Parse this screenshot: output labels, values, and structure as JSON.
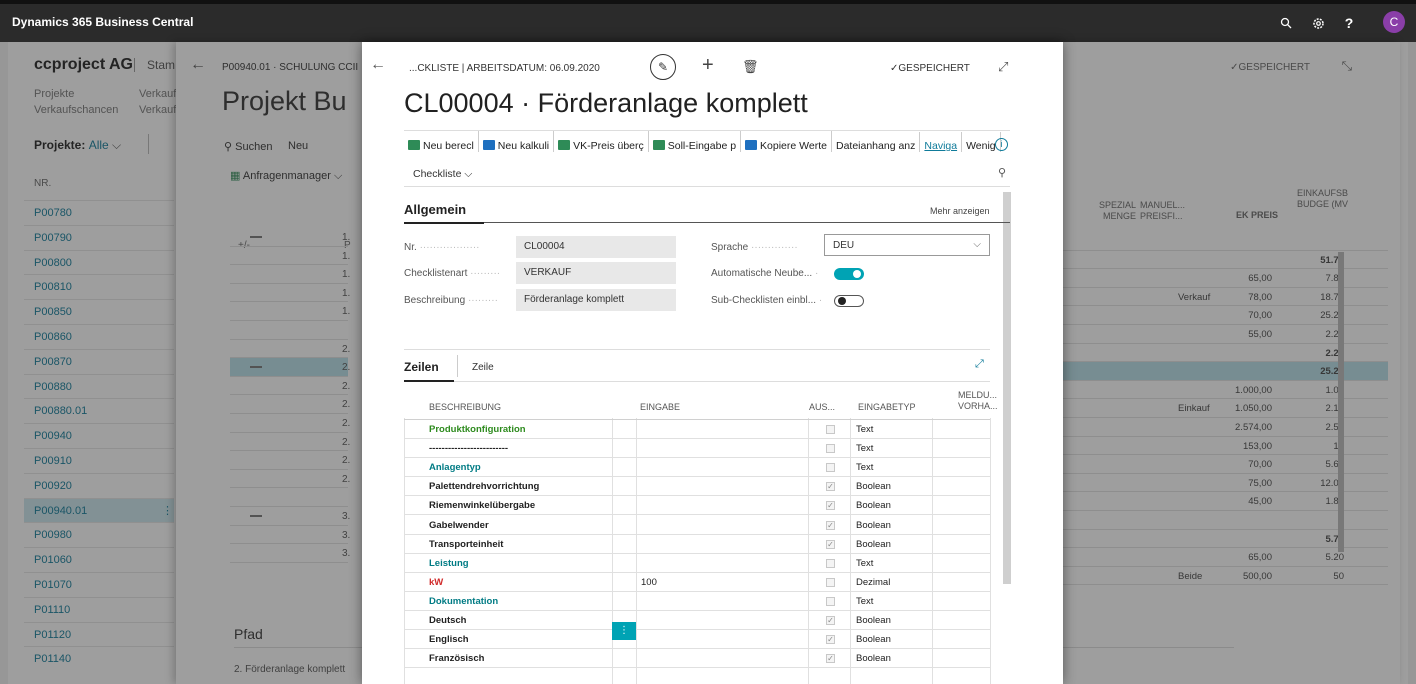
{
  "app": {
    "title": "Dynamics 365 Business Central",
    "avatar": "C"
  },
  "colors": {
    "accent": "#00a3b4",
    "link": "#0f7b9a",
    "green_caption": "#2e8b1e",
    "teal_caption": "#007b84",
    "red_caption": "#d12b2b",
    "topbar": "#2b2b2b"
  },
  "topbar": {
    "icons": [
      "search-icon",
      "gear-icon",
      "help-icon"
    ],
    "help": "?"
  },
  "layer1": {
    "company": "ccproject AG",
    "stam": "Stam",
    "nav": [
      [
        "Projekte",
        "Verkauf:"
      ],
      [
        "Verkaufschancen",
        "Verkauf:"
      ]
    ],
    "filter_label": "Projekte:",
    "filter_value": "Alle",
    "col_nr": "NR.",
    "projects": [
      "P00780",
      "P00790",
      "P00800",
      "P00810",
      "P00850",
      "P00860",
      "P00870",
      "P00880",
      "P00880.01",
      "P00940",
      "P00910",
      "P00920",
      "P00940.01",
      "P00980",
      "P01060",
      "P01070",
      "P01110",
      "P01120",
      "P01140"
    ]
  },
  "layer2": {
    "crumb": "P00940.01 · SCHULUNG CCII",
    "title": "Projekt Bu",
    "saved": "GESPEICHERT",
    "search": "Suchen",
    "neu": "Neu",
    "anfragen": "Anfragenmanager",
    "col_plusminus": "+/-",
    "col_p": "P",
    "pfad": "Pfad",
    "pfad_text": "2. Förderanlage komplett",
    "rows_prefix": [
      "1.",
      "1.",
      "1.",
      "1.",
      "1.",
      "",
      "2.",
      "2.",
      "2.",
      "2.",
      "2.",
      "2.",
      "2.",
      "2.",
      "",
      "3.",
      "3.",
      "3."
    ],
    "right_headers": {
      "spezial": "SPEZIAL MENGE",
      "manuel": "MANUEL... PREISFI...",
      "ek": "EK PREIS",
      "einkauf": "EINKAUFSB BUDGE (MV"
    },
    "right_rows": [
      {
        "m": "",
        "ek": "",
        "b": ""
      },
      {
        "m": "",
        "ek": "",
        "b": "51.71"
      },
      {
        "m": "",
        "ek": "65,00",
        "b": "7.80"
      },
      {
        "m": "Verkauf",
        "ek": "78,00",
        "b": "18.72"
      },
      {
        "m": "",
        "ek": "70,00",
        "b": "25.20"
      },
      {
        "m": "",
        "ek": "55,00",
        "b": "2.20"
      },
      {
        "m": "",
        "ek": "",
        "b": "2.20"
      },
      {
        "m": "",
        "ek": "",
        "b": "25.22"
      },
      {
        "m": "",
        "ek": "1.000,00",
        "b": "1.00"
      },
      {
        "m": "Einkauf",
        "ek": "1.050,00",
        "b": "2.10"
      },
      {
        "m": "",
        "ek": "2.574,00",
        "b": "2.57"
      },
      {
        "m": "",
        "ek": "153,00",
        "b": "15"
      },
      {
        "m": "",
        "ek": "70,00",
        "b": "5.60"
      },
      {
        "m": "",
        "ek": "75,00",
        "b": "12.00"
      },
      {
        "m": "",
        "ek": "45,00",
        "b": "1.80"
      },
      {
        "m": "",
        "ek": "",
        "b": ""
      },
      {
        "m": "",
        "ek": "",
        "b": "5.70"
      },
      {
        "m": "",
        "ek": "65,00",
        "b": "5.20"
      },
      {
        "m": "Beide",
        "ek": "500,00",
        "b": "50"
      }
    ]
  },
  "modal": {
    "crumb": "...CKLISTE | ARBEITSDATUM: 06.09.2020",
    "saved": "GESPEICHERT",
    "title": "CL00004 · Förderanlage komplett",
    "actions": [
      {
        "label": "Neu berecl",
        "color": "#2e8b57"
      },
      {
        "label": "Neu kalkuli",
        "color": "#1e6fbf"
      },
      {
        "label": "VK-Preis überç",
        "color": "#2e8b57"
      },
      {
        "label": "Soll-Eingabe p",
        "color": "#2e8b57"
      },
      {
        "label": "Kopiere Werte",
        "color": "#1e6fbf"
      },
      {
        "label": "Dateianhang anz",
        "color": ""
      },
      {
        "label": "Naviga",
        "color": ""
      },
      {
        "label": "Wenig",
        "color": ""
      }
    ],
    "checkliste": "Checkliste",
    "section": "Allgemein",
    "mehr": "Mehr anzeigen",
    "fields": {
      "nr_label": "Nr.",
      "nr": "CL00004",
      "art_label": "Checklistenart",
      "art": "VERKAUF",
      "desc_label": "Beschreibung",
      "desc": "Förderanlage komplett",
      "sprache_label": "Sprache",
      "sprache": "DEU",
      "auto_label": "Automatische Neube...",
      "auto": true,
      "sub_label": "Sub-Checklisten einbl...",
      "sub": false
    },
    "zeilen": "Zeilen",
    "zeile": "Zeile",
    "table": {
      "headers": {
        "beschreibung": "BESCHREIBUNG",
        "eingabe": "EINGABE",
        "aus": "AUS...",
        "typ": "EINGABETYP",
        "meld1": "MELDU...",
        "meld2": "VORHA..."
      },
      "rows": [
        {
          "text": "Produktkonfiguration",
          "style": "green",
          "eingabe": "",
          "checked": false,
          "typ": "Text"
        },
        {
          "text": "-------------------------",
          "style": "plain",
          "eingabe": "",
          "checked": false,
          "typ": "Text"
        },
        {
          "text": "Anlagentyp",
          "style": "teal",
          "eingabe": "",
          "checked": false,
          "typ": "Text"
        },
        {
          "text": "Palettendrehvorrichtung",
          "style": "bold",
          "eingabe": "",
          "checked": true,
          "typ": "Boolean"
        },
        {
          "text": "Riemenwinkelübergabe",
          "style": "bold",
          "eingabe": "",
          "checked": true,
          "typ": "Boolean"
        },
        {
          "text": "Gabelwender",
          "style": "bold",
          "eingabe": "",
          "checked": true,
          "typ": "Boolean"
        },
        {
          "text": "Transporteinheit",
          "style": "bold",
          "eingabe": "",
          "checked": true,
          "typ": "Boolean"
        },
        {
          "text": "Leistung",
          "style": "teal",
          "eingabe": "",
          "checked": false,
          "typ": "Text"
        },
        {
          "text": "kW",
          "style": "red",
          "eingabe": "100",
          "checked": false,
          "typ": "Dezimal"
        },
        {
          "text": "Dokumentation",
          "style": "teal",
          "eingabe": "",
          "checked": false,
          "typ": "Text"
        },
        {
          "text": "Deutsch",
          "style": "bold",
          "eingabe": "",
          "checked": true,
          "typ": "Boolean"
        },
        {
          "text": "Englisch",
          "style": "bold",
          "eingabe": "",
          "checked": true,
          "typ": "Boolean"
        },
        {
          "text": "Französisch",
          "style": "bold",
          "eingabe": "",
          "checked": true,
          "typ": "Boolean"
        }
      ]
    }
  }
}
